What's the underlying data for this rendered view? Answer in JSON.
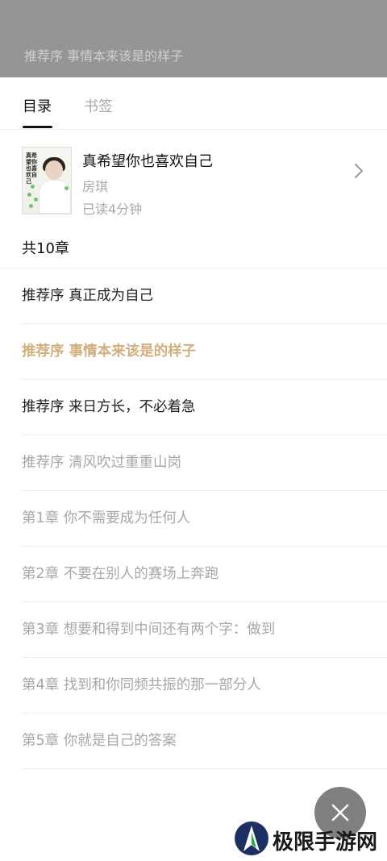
{
  "overlay": {
    "current_chapter": "推荐序 事情本来该是的样子"
  },
  "tabs": [
    {
      "label": "目录",
      "active": true
    },
    {
      "label": "书签",
      "active": false
    }
  ],
  "book": {
    "title": "真希望你也喜欢自己",
    "author": "房琪",
    "read_time": "已读4分钟",
    "cover_title": "真希望你也喜欢自己"
  },
  "chapter_count": "共10章",
  "chapters": [
    {
      "label": "推荐序 真正成为自己",
      "state": "read"
    },
    {
      "label": "推荐序 事情本来该是的样子",
      "state": "current"
    },
    {
      "label": "推荐序 来日方长，不必着急",
      "state": "read"
    },
    {
      "label": "推荐序 清风吹过重重山岗",
      "state": "unread"
    },
    {
      "label": "第1章 你不需要成为任何人",
      "state": "unread"
    },
    {
      "label": "第2章 不要在别人的赛场上奔跑",
      "state": "unread"
    },
    {
      "label": "第3章 想要和得到中间还有两个字：做到",
      "state": "unread"
    },
    {
      "label": "第4章 找到和你同频共振的那一部分人",
      "state": "unread"
    },
    {
      "label": "第5章 你就是自己的答案",
      "state": "unread"
    }
  ],
  "colors": {
    "current_chapter": "#d1ae7d",
    "read_chapter": "#222222",
    "unread_chapter": "#a7a7a7",
    "overlay": "#959595"
  },
  "icons": {
    "close": "close-icon",
    "chevron": "chevron-right-icon"
  },
  "watermark": {
    "text": "极限手游网"
  }
}
